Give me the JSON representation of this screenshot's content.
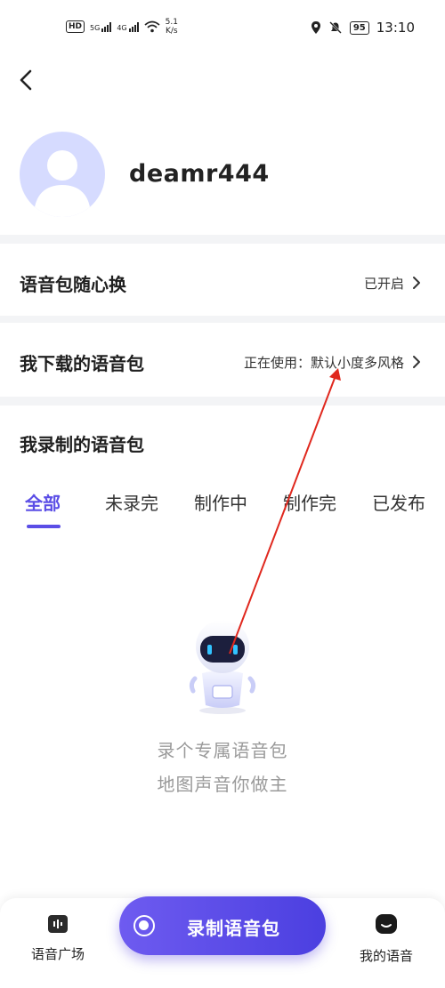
{
  "status_bar": {
    "hd_label": "HD",
    "sim1": "5G",
    "sim2": "4G",
    "speed_value": "5.1",
    "speed_unit": "K/s",
    "battery": "95",
    "time": "13:10"
  },
  "profile": {
    "username": "deamr444"
  },
  "rows": [
    {
      "title": "语音包随心换",
      "value": "已开启"
    },
    {
      "title": "我下载的语音包",
      "value": "正在使用：默认小度多风格"
    }
  ],
  "recorded": {
    "title": "我录制的语音包",
    "tabs": [
      "全部",
      "未录完",
      "制作中",
      "制作完",
      "已发布"
    ],
    "active_tab": 0,
    "empty_line1": "录个专属语音包",
    "empty_line2": "地图声音你做主"
  },
  "bottom_nav": {
    "left_label": "语音广场",
    "record_label": "录制语音包",
    "right_label": "我的语音"
  },
  "colors": {
    "accent": "#5b4ee6",
    "annotation_arrow": "#e0281e"
  }
}
